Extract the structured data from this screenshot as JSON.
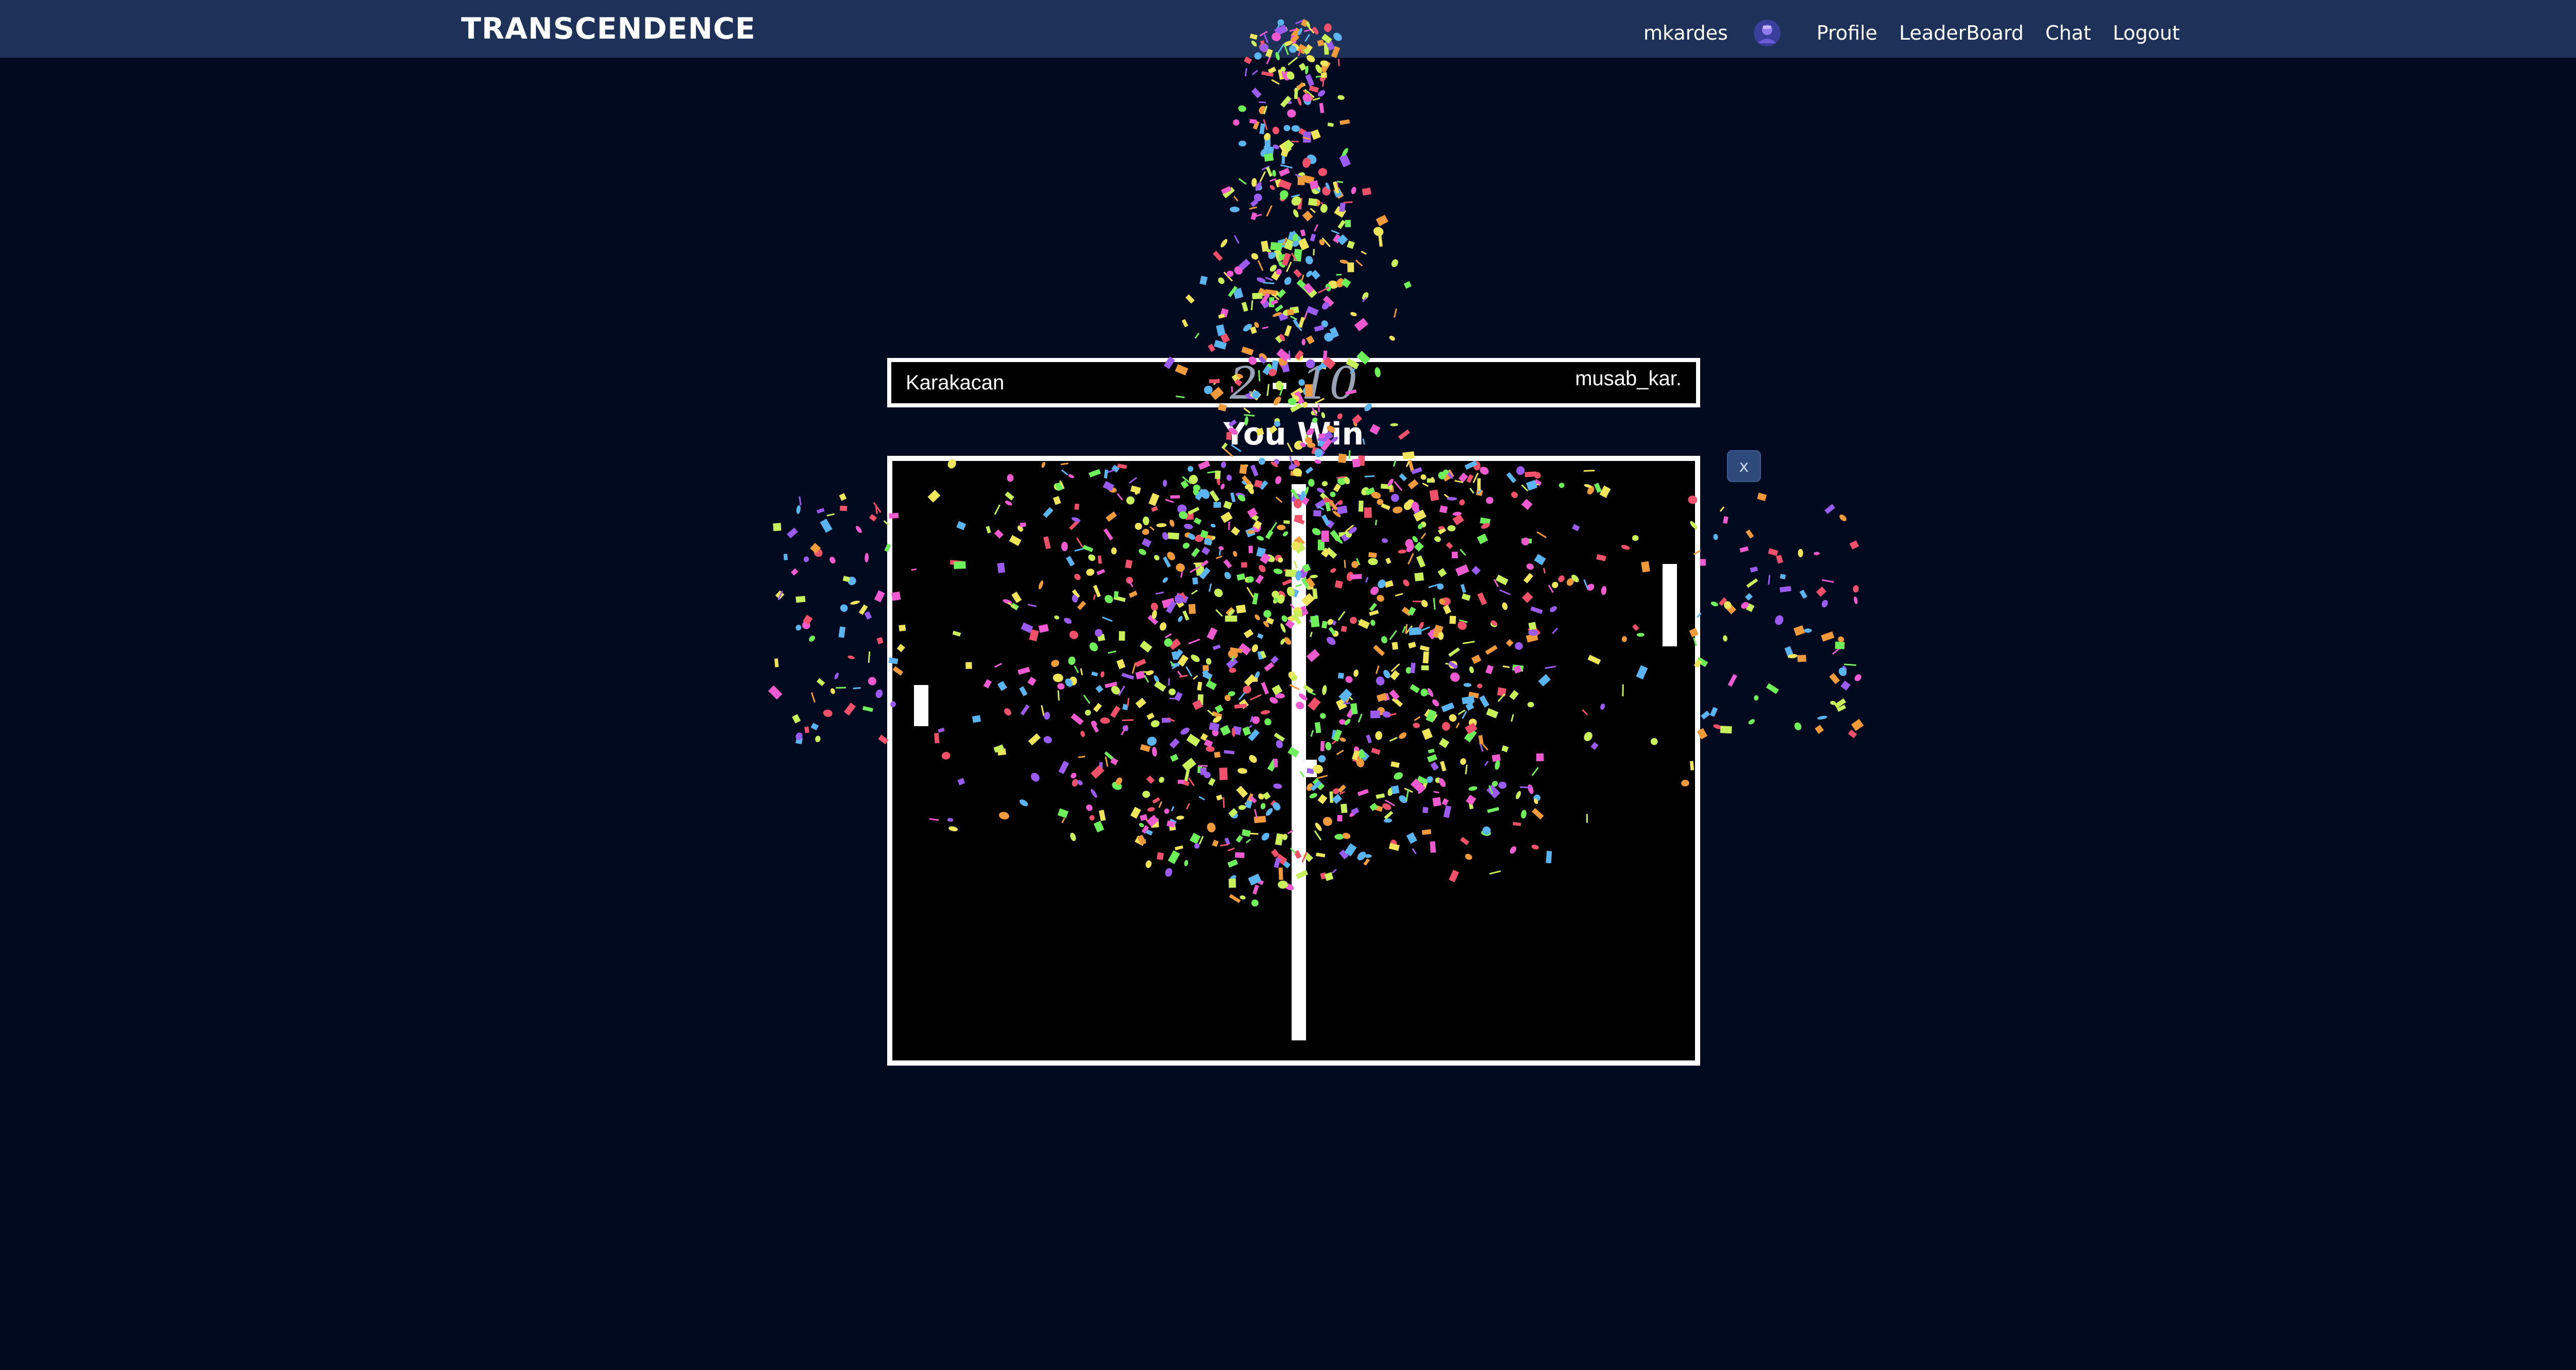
{
  "navbar": {
    "brand": "TRANSCENDENCE",
    "username": "mkardes",
    "avatar_icon": "user-avatar-icon",
    "links": [
      "Profile",
      "LeaderBoard",
      "Chat",
      "Logout"
    ]
  },
  "game": {
    "player_left": "Karakacan",
    "player_right": "musab_kar.",
    "score_left": "2",
    "score_separator": "-",
    "score_right": "10",
    "result": "You Win",
    "close_label": "x"
  },
  "colors": {
    "background": "#020a20",
    "navbar": "#1e3159",
    "board": "#000000",
    "border": "#ffffff",
    "confetti": [
      "#f0e55a",
      "#9c5bf0",
      "#f05ad0",
      "#5ab4f0",
      "#f09a3c",
      "#6ef05a",
      "#f0506a",
      "#c8f05a"
    ]
  }
}
